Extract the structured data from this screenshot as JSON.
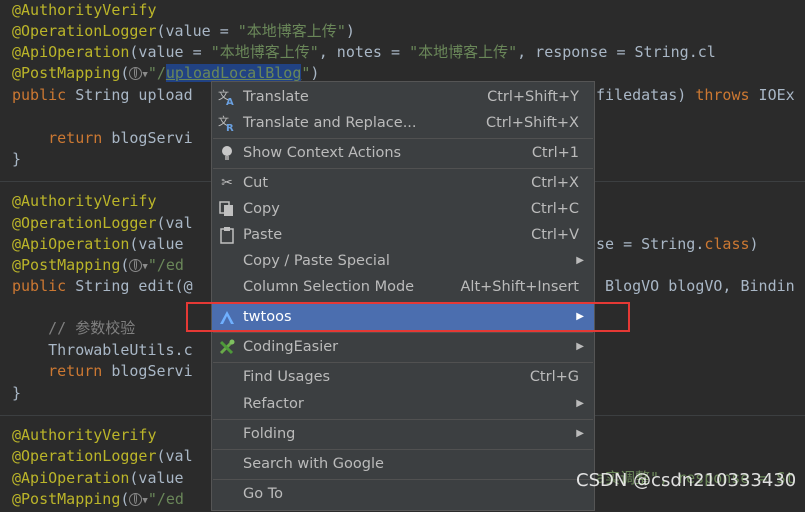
{
  "editor": {
    "b1_l1": "@AuthorityVerify",
    "b1_l2_ann": "@OperationLogger",
    "b1_l2_a": "(value = ",
    "b1_l2_s": "\"本地博客上传\"",
    "b1_l2_b": ")",
    "b1_l3_ann": "@ApiOperation",
    "b1_l3_a": "(value = ",
    "b1_l3_s1": "\"本地博客上传\"",
    "b1_l3_b": ", notes = ",
    "b1_l3_s2": "\"本地博客上传\"",
    "b1_l3_c": ", response = String.cl",
    "b1_l4_ann": "@PostMapping",
    "b1_l4_a": "(",
    "b1_l4_s1": "\"/",
    "b1_l4_sel": "uploadLocalBlog",
    "b1_l4_s2": "\"",
    "b1_l4_b": ")",
    "b1_l5_kw": "public",
    "b1_l5_a": " String upload",
    "b1_l5_r": "filedatas) ",
    "b1_l5_kw2": "throws",
    "b1_l5_c": " IOEx",
    "b1_l6_kw": "    return",
    "b1_l6_a": " blogServi",
    "b1_l7": "}",
    "b2_l1": "@AuthorityVerify",
    "b2_l2_ann": "@OperationLogger",
    "b2_l2_a": "(val",
    "b2_l3_ann": "@ApiOperation",
    "b2_l3_a": "(value",
    "b2_l3_r": "se = String.",
    "b2_l3_kw": "class",
    "b2_l3_c": ")",
    "b2_l4_ann": "@PostMapping",
    "b2_l4_a": "(",
    "b2_l4_s": "\"/ed",
    "b2_l5_kw": "public",
    "b2_l5_a": " String edit(@",
    "b2_l5_r": " BlogVO blogVO, Bindin",
    "b2_l6_c": "    // 参数校验",
    "b2_l7": "    ThrowableUtils.c",
    "b2_l8_kw": "    return",
    "b2_l8_a": " blogServi",
    "b2_l9": "}",
    "b3_l1": "@AuthorityVerify",
    "b3_l2_ann": "@OperationLogger",
    "b3_l2_a": "(val",
    "b3_l3_ann": "@ApiOperation",
    "b3_l3_a": "(value",
    "b3_l3_r": "a实调整\", response = St",
    "b3_l4_ann": "@PostMapping",
    "b3_l4_a": "(",
    "b3_l4_s": "\"/ed"
  },
  "context_menu": {
    "items": [
      {
        "label": "Translate",
        "shortcut": "Ctrl+Shift+Y",
        "icon": "translate-icon"
      },
      {
        "label": "Translate and Replace...",
        "shortcut": "Ctrl+Shift+X",
        "icon": "translate-replace-icon"
      },
      {
        "label": "Show Context Actions",
        "shortcut": "Ctrl+1",
        "icon": "lightbulb-icon"
      },
      {
        "label": "Cut",
        "shortcut": "Ctrl+X",
        "icon": "scissors-icon"
      },
      {
        "label": "Copy",
        "shortcut": "Ctrl+C",
        "icon": "copy-icon"
      },
      {
        "label": "Paste",
        "shortcut": "Ctrl+V",
        "icon": "clipboard-icon"
      },
      {
        "label": "Copy / Paste Special",
        "shortcut": "",
        "icon": ""
      },
      {
        "label": "Column Selection Mode",
        "shortcut": "Alt+Shift+Insert",
        "icon": ""
      },
      {
        "label": "twtoos",
        "shortcut": "",
        "icon": "twtoos-logo-icon"
      },
      {
        "label": "CodingEasier",
        "shortcut": "",
        "icon": "coding-easier-icon"
      },
      {
        "label": "Find Usages",
        "shortcut": "Ctrl+G",
        "icon": ""
      },
      {
        "label": "Refactor",
        "shortcut": "",
        "icon": ""
      },
      {
        "label": "Folding",
        "shortcut": "",
        "icon": ""
      },
      {
        "label": "Search with Google",
        "shortcut": "",
        "icon": ""
      },
      {
        "label": "Go To",
        "shortcut": "",
        "icon": ""
      }
    ]
  },
  "watermark": "CSDN @csdn210333430",
  "colors": {
    "menu_bg": "#3c3f41",
    "active_bg": "#4b6eaf",
    "highlight_border": "#e53935",
    "editor_bg": "#2b2b2b"
  }
}
